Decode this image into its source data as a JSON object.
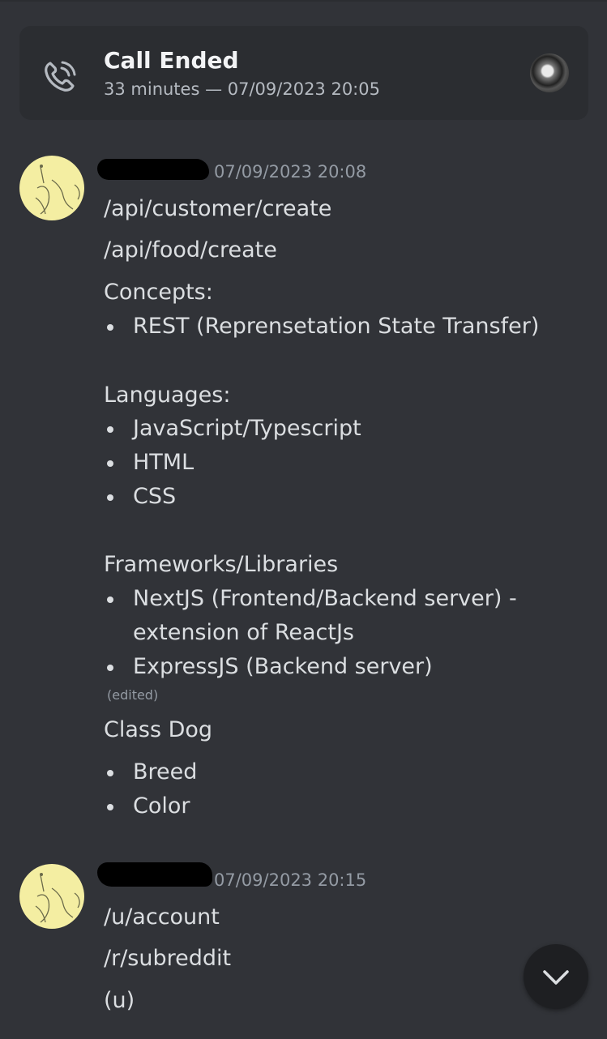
{
  "call": {
    "title": "Call Ended",
    "subtitle": "33 minutes — 07/09/2023 20:05",
    "icon": "phone-call-icon"
  },
  "messages": [
    {
      "author": "",
      "timestamp": "07/09/2023 20:08",
      "lines": {
        "l1": "/api/customer/create",
        "l2": "/api/food/create",
        "l3": "Concepts:",
        "b1": "REST (Reprensetation State Transfer)",
        "l4": "Languages:",
        "b2": "JavaScript/Typescript",
        "b3": "HTML",
        "b4": "CSS",
        "l5": "Frameworks/Libraries",
        "b5a": "NextJS (Frontend/Backend server) -",
        "b5b": "extension of ReactJs",
        "b6": "ExpressJS (Backend server)",
        "edited": "(edited)",
        "l6": "Class Dog",
        "b7": "Breed",
        "b8": "Color"
      }
    },
    {
      "author": "",
      "timestamp": "07/09/2023 20:15",
      "lines": {
        "l1": "/u/account",
        "l2": "/r/subreddit",
        "l3": "(u)"
      }
    }
  ],
  "scroll_button": {
    "icon": "chevron-down-icon"
  },
  "colors": {
    "background": "#313338",
    "card": "#2b2d31",
    "avatar": "#f4eea2"
  }
}
